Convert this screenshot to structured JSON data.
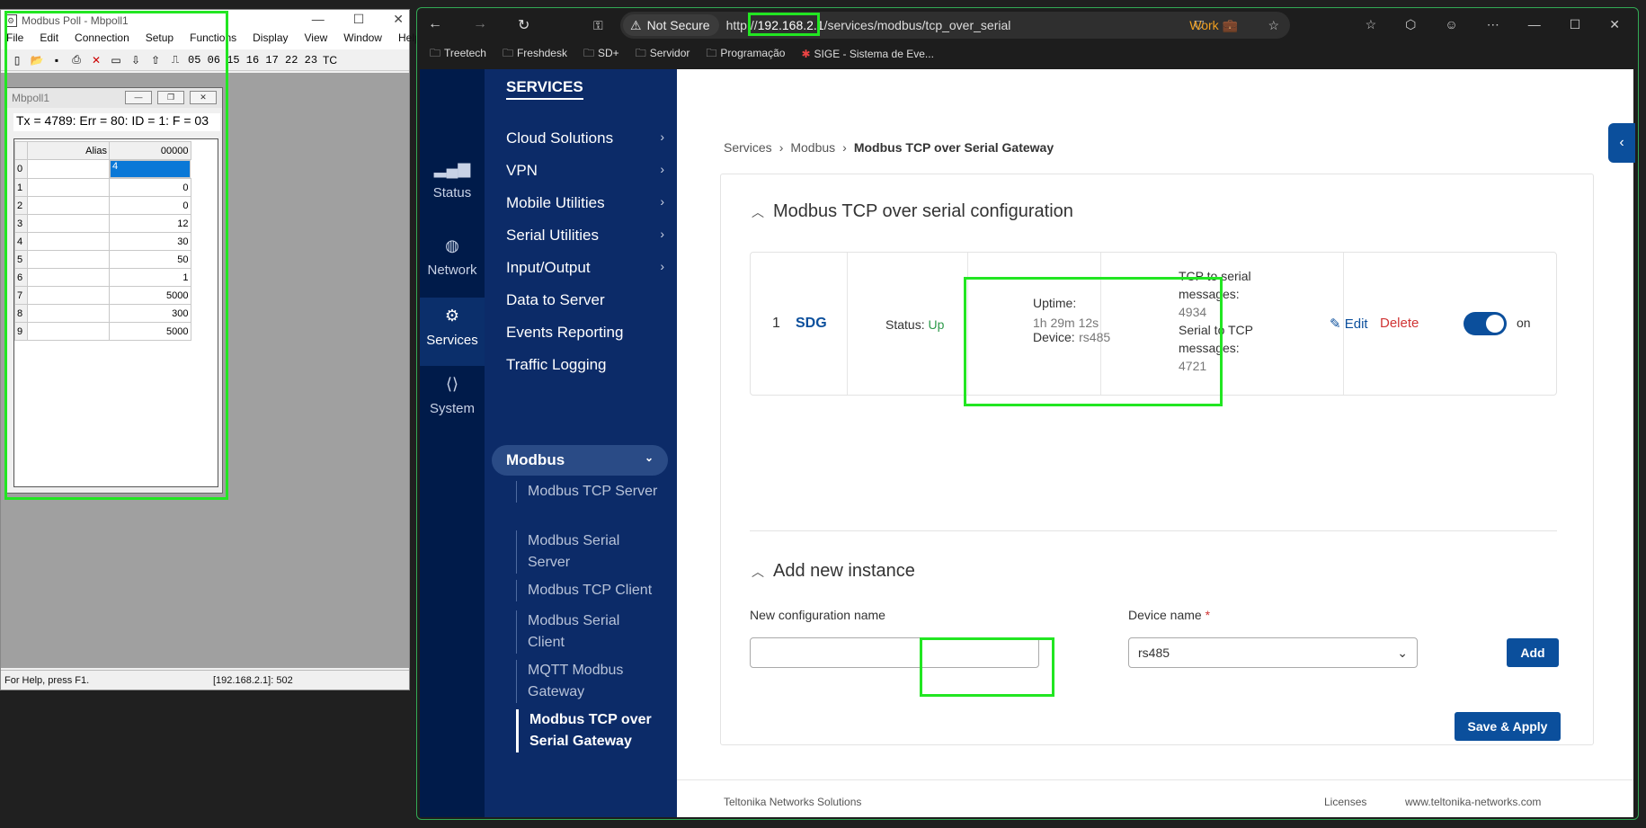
{
  "modbus_poll": {
    "title": "Modbus Poll - Mbpoll1",
    "menu": [
      "File",
      "Edit",
      "Connection",
      "Setup",
      "Functions",
      "Display",
      "View",
      "Window",
      "Help"
    ],
    "function_codes": "05 06 15 16 17 22 23",
    "tc_label": "TC",
    "child_title": "Mbpoll1",
    "status_line": "Tx = 4789: Err = 80: ID = 1: F = 03",
    "grid": {
      "col_alias": "Alias",
      "col_address": "00000",
      "rows": [
        {
          "index": "0",
          "value": "4"
        },
        {
          "index": "1",
          "value": "0"
        },
        {
          "index": "2",
          "value": "0"
        },
        {
          "index": "3",
          "value": "12"
        },
        {
          "index": "4",
          "value": "30"
        },
        {
          "index": "5",
          "value": "50"
        },
        {
          "index": "6",
          "value": "1"
        },
        {
          "index": "7",
          "value": "5000"
        },
        {
          "index": "8",
          "value": "300"
        },
        {
          "index": "9",
          "value": "5000"
        }
      ]
    },
    "statusbar_help": "For Help, press F1.",
    "statusbar_conn": "[192.168.2.1]: 502"
  },
  "browser": {
    "not_secure": "Not Secure",
    "url_prefix": "http://",
    "url_host": "192.168.2.1",
    "url_path": "/services/modbus/tcp_over_serial",
    "profile": "Work",
    "bookmarks": [
      "Treetech",
      "Freshdesk",
      "SD+",
      "Servidor",
      "Programação",
      "SIGE - Sistema de Eve..."
    ]
  },
  "rail": {
    "status": "Status",
    "network": "Network",
    "services": "Services",
    "system": "System"
  },
  "sidebar": {
    "heading": "SERVICES",
    "items": [
      "Cloud Solutions",
      "VPN",
      "Mobile Utilities",
      "Serial Utilities",
      "Input/Output",
      "Data to Server",
      "Events Reporting",
      "Traffic Logging"
    ],
    "modbus": "Modbus",
    "sub_items": [
      "Modbus TCP Server",
      "Modbus Serial Server",
      "Modbus TCP Client",
      "Modbus Serial Client",
      "MQTT Modbus Gateway",
      "Modbus TCP over Serial Gateway"
    ]
  },
  "breadcrumb": [
    "Services",
    "Modbus",
    "Modbus TCP over Serial Gateway"
  ],
  "config": {
    "section_title": "Modbus TCP over serial configuration",
    "instance": {
      "number": "1",
      "name": "SDG",
      "status_label": "Status:",
      "status_value": "Up",
      "uptime_label": "Uptime:",
      "uptime_value": "1h 29m 12s",
      "device_label": "Device:",
      "device_value": "rs485",
      "tcp_serial_label": "TCP to serial messages:",
      "tcp_serial_value": "4934",
      "serial_tcp_label": "Serial to TCP messages:",
      "serial_tcp_value": "4721",
      "edit": "Edit",
      "delete": "Delete",
      "toggle_label": "on"
    }
  },
  "add_instance": {
    "section_title": "Add new instance",
    "name_label": "New configuration name",
    "name_value": "",
    "device_label": "Device name",
    "device_value": "rs485",
    "add_button": "Add"
  },
  "save_apply": "Save & Apply",
  "footer": {
    "company": "Teltonika Networks Solutions",
    "licenses": "Licenses",
    "site": "www.teltonika-networks.com"
  },
  "colors": {
    "accent": "#0b4f9c",
    "highlight": "#22e622",
    "status_up": "#2e9a4b",
    "delete": "#d03434"
  }
}
